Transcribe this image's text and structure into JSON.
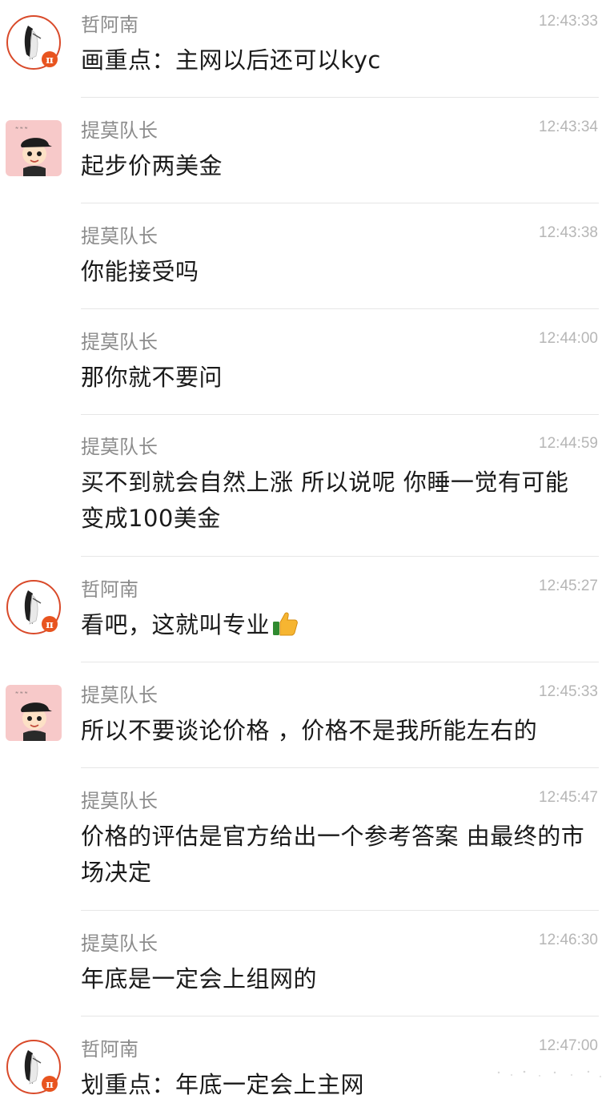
{
  "messages": [
    {
      "sender": "哲阿南",
      "time": "12:43:33",
      "text": "画重点：主网以后还可以kyc",
      "avatar": "pi-avatar"
    },
    {
      "sender": "提莫队长",
      "time": "12:43:34",
      "text": "起步价两美金",
      "avatar": "cartoon-avatar"
    },
    {
      "sender": "提莫队长",
      "time": "12:43:38",
      "text": "你能接受吗",
      "avatar": ""
    },
    {
      "sender": "提莫队长",
      "time": "12:44:00",
      "text": "那你就不要问",
      "avatar": ""
    },
    {
      "sender": "提莫队长",
      "time": "12:44:59",
      "text": "买不到就会自然上涨 所以说呢 你睡一觉有可能变成100美金",
      "avatar": ""
    },
    {
      "sender": "哲阿南",
      "time": "12:45:27",
      "text": "看吧，这就叫专业",
      "avatar": "pi-avatar"
    },
    {
      "sender": "提莫队长",
      "time": "12:45:33",
      "text": "所以不要谈论价格 ，价格不是我所能左右的",
      "avatar": "cartoon-avatar"
    },
    {
      "sender": "提莫队长",
      "time": "12:45:47",
      "text": "价格的评估是官方给出一个参考答案 由最终的市场决定",
      "avatar": ""
    },
    {
      "sender": "提莫队长",
      "time": "12:46:30",
      "text": "年底是一定会上组网的",
      "avatar": ""
    },
    {
      "sender": "哲阿南",
      "time": "12:47:00",
      "text": "划重点：年底一定会上主网",
      "avatar": "pi-avatar"
    }
  ],
  "icons": {
    "thumbs_up": "thumbs-up-icon",
    "pi_badge": "pi-badge-icon"
  },
  "colors": {
    "sender": "#8c8c8c",
    "time": "#b6b6b6",
    "text": "#1a1a1a",
    "divider": "#e6e6e6",
    "pi_badge": "#e8541f",
    "cartoon_bg": "#f7c9c9"
  }
}
